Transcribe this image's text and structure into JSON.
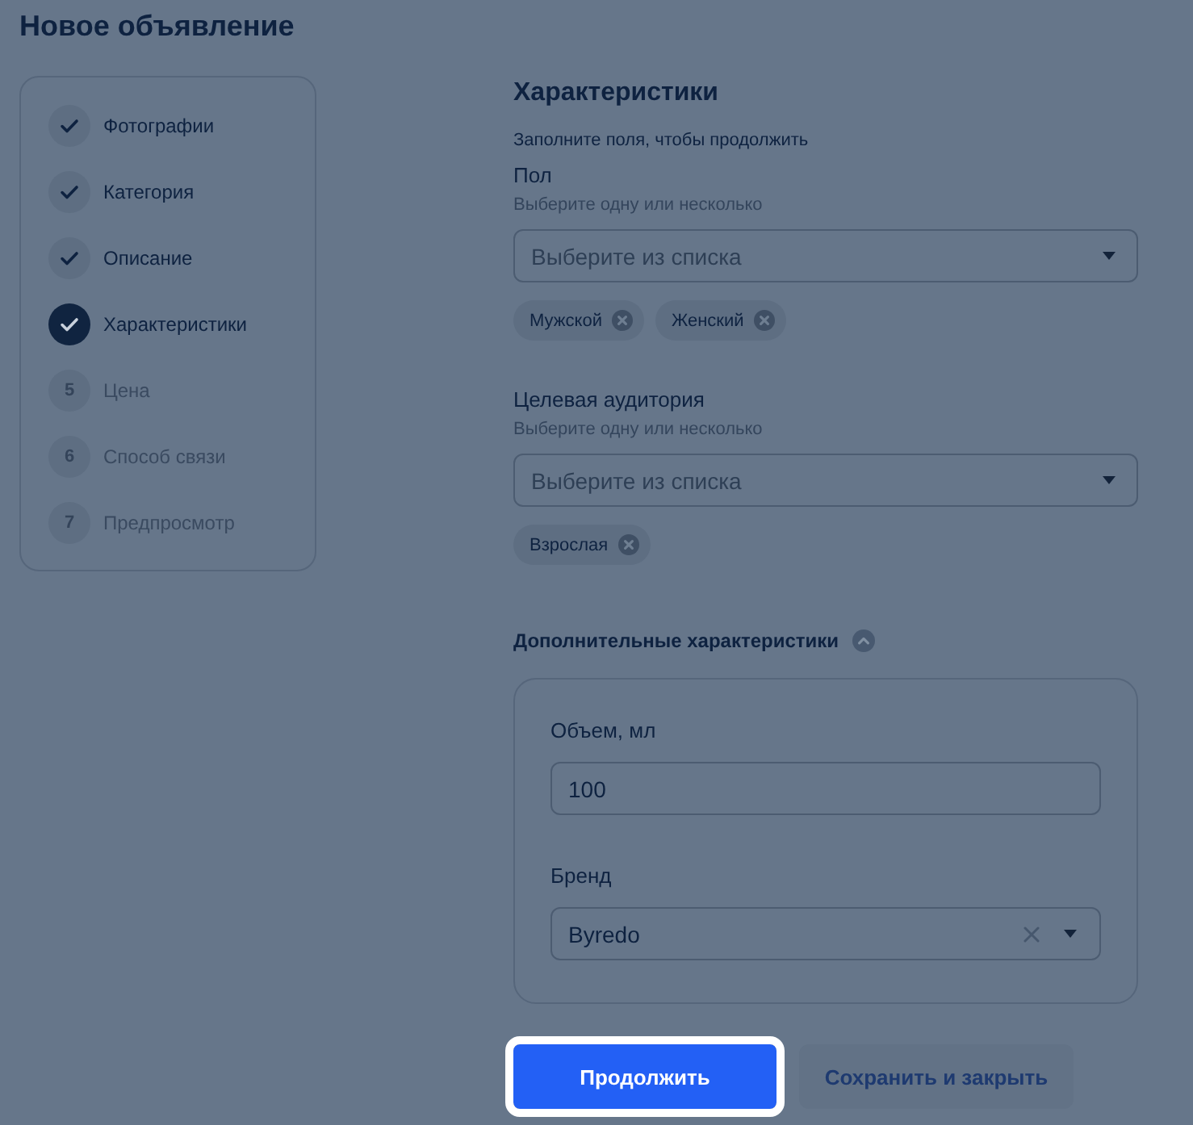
{
  "page": {
    "title": "Новое объявление"
  },
  "steps": [
    {
      "label": "Фотографии",
      "completed": true,
      "selected": false
    },
    {
      "label": "Категория",
      "completed": true,
      "selected": false
    },
    {
      "label": "Описание",
      "completed": true,
      "selected": false
    },
    {
      "label": "Характеристики",
      "completed": true,
      "selected": true
    },
    {
      "number": "5",
      "label": "Цена",
      "completed": false,
      "selected": false
    },
    {
      "number": "6",
      "label": "Способ связи",
      "completed": false,
      "selected": false
    },
    {
      "number": "7",
      "label": "Предпросмотр",
      "completed": false,
      "selected": false
    }
  ],
  "section": {
    "title": "Характеристики",
    "subtitle": "Заполните поля, чтобы продолжить",
    "fields": [
      {
        "label": "Пол",
        "hint": "Выберите одну или несколько",
        "placeholder": "Выберите из списка",
        "chips": [
          "Мужской",
          "Женский"
        ]
      },
      {
        "label": "Целевая аудитория",
        "hint": "Выберите одну или несколько",
        "placeholder": "Выберите из списка",
        "chips": [
          "Взрослая"
        ]
      }
    ]
  },
  "extra": {
    "title": "Дополнительные характеристики",
    "expanded": true,
    "fields": [
      {
        "kind": "text",
        "label": "Объем, мл",
        "value": "100"
      },
      {
        "kind": "select",
        "label": "Бренд",
        "value": "Byredo",
        "clearable": true
      }
    ]
  },
  "actions": [
    {
      "kind": "primary",
      "label": "Продолжить",
      "highlighted": true
    },
    {
      "kind": "secondary",
      "label": "Сохранить и закрыть",
      "highlighted": false
    }
  ]
}
